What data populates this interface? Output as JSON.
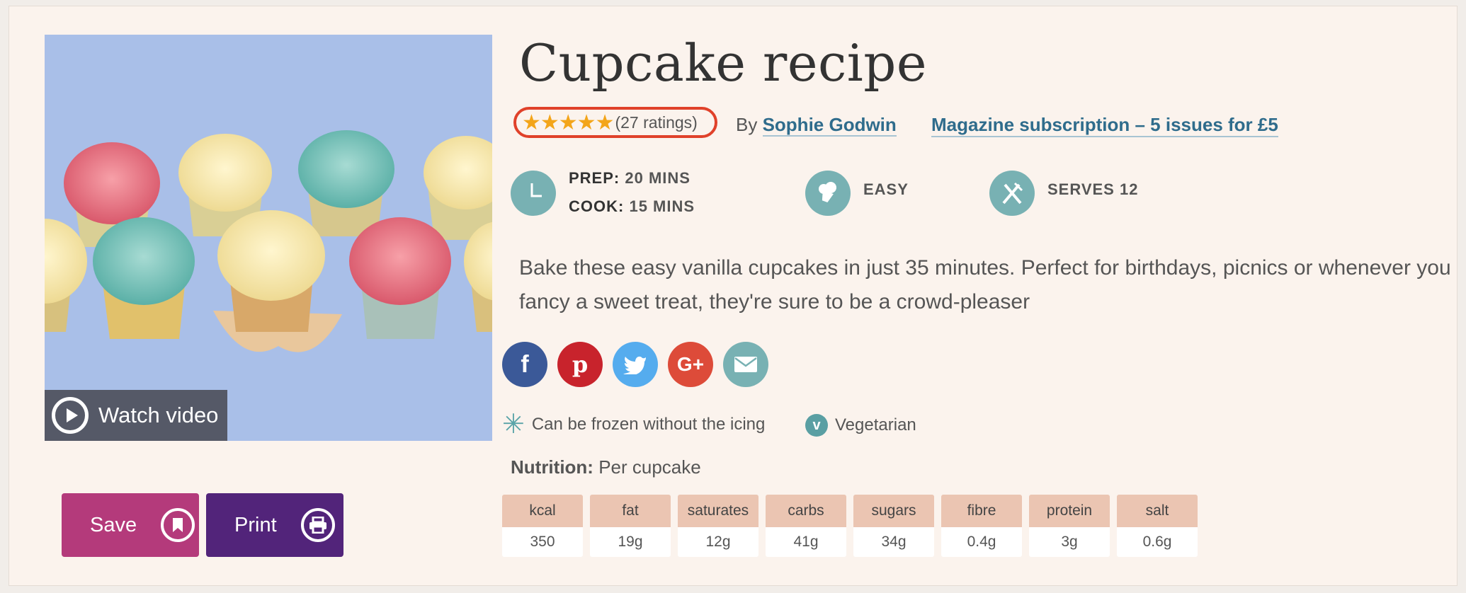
{
  "recipe": {
    "title": "Cupcake recipe",
    "ratings": "(27 ratings)",
    "stars": "★★★★★",
    "by_prefix": "By",
    "author": "Sophie Godwin",
    "subscription": "Magazine subscription – 5 issues for £5",
    "prep_label": "PREP:",
    "prep_value": "20 MINS",
    "cook_label": "COOK:",
    "cook_value": "15 MINS",
    "difficulty": "EASY",
    "serves": "SERVES 12",
    "description": "Bake these easy vanilla cupcakes in just 35 minutes. Perfect for birthdays, picnics or whenever you fancy a sweet treat, they're sure to be a crowd-pleaser",
    "watch_video": "Watch video",
    "save": "Save",
    "print": "Print",
    "tag_frozen": "Can be frozen without the icing",
    "tag_veg": "Vegetarian",
    "nutrition_label": "Nutrition:",
    "nutrition_per": "Per cupcake"
  },
  "nutrition": [
    {
      "name": "kcal",
      "value": "350"
    },
    {
      "name": "fat",
      "value": "19g"
    },
    {
      "name": "saturates",
      "value": "12g"
    },
    {
      "name": "carbs",
      "value": "41g"
    },
    {
      "name": "sugars",
      "value": "34g"
    },
    {
      "name": "fibre",
      "value": "0.4g"
    },
    {
      "name": "protein",
      "value": "3g"
    },
    {
      "name": "salt",
      "value": "0.6g"
    }
  ],
  "colors": {
    "accent_save": "#b43a7b",
    "accent_print": "#52247a",
    "rating_outline": "#e0412a",
    "star": "#f3a51a",
    "link": "#2f6c8c",
    "icon_teal": "#78b1b3"
  }
}
